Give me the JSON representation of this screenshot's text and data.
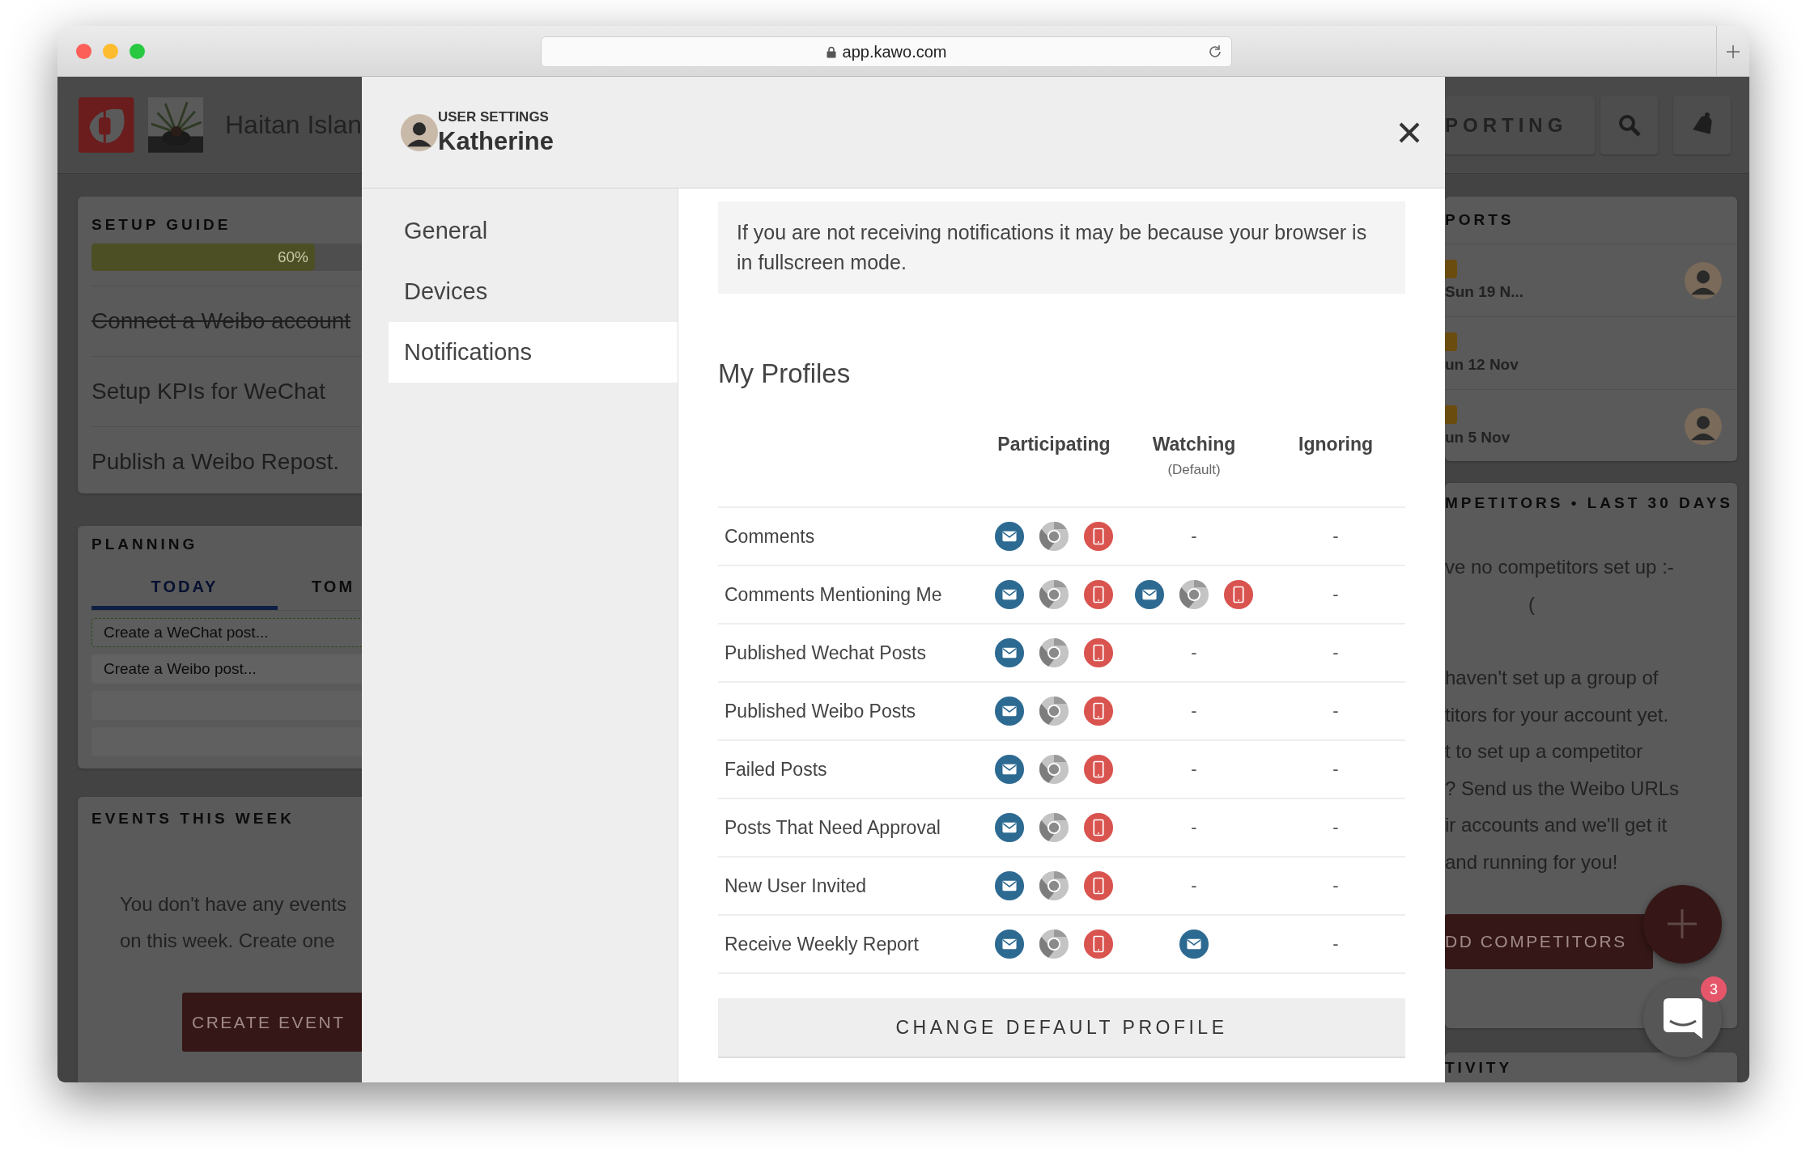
{
  "browser": {
    "url": "app.kawo.com"
  },
  "left": {
    "header_title": "Haitan Islan",
    "setup": {
      "title": "SETUP GUIDE",
      "progress": {
        "level": 0.6,
        "label": "60%"
      },
      "tasks": [
        {
          "label": "Connect a Weibo account",
          "done": true
        },
        {
          "label": "Setup KPIs for WeChat",
          "done": false
        },
        {
          "label": "Publish a Weibo Repost.",
          "done": false
        }
      ]
    },
    "planning": {
      "title": "PLANNING",
      "tabs": [
        {
          "label": "TODAY",
          "selected": true
        },
        {
          "label": "TOM",
          "selected": false
        }
      ],
      "fields": [
        {
          "placeholder": "Create a WeChat post...",
          "highlighted": true
        },
        {
          "placeholder": "Create a Weibo post...",
          "highlighted": false
        }
      ]
    },
    "events": {
      "title": "EVENTS THIS WEEK",
      "lines": [
        "You don't have any events",
        "on this week. Create one"
      ],
      "button": "CREATE EVENT"
    }
  },
  "right": {
    "nav_label": "PORTING",
    "reports": {
      "title": "PORTS",
      "items": [
        {
          "date": "Sun 19 N...",
          "avatar": true
        },
        {
          "date": "un 12 Nov",
          "avatar": false
        },
        {
          "date": "un 5 Nov",
          "avatar": true
        }
      ]
    },
    "competitors": {
      "title": "MPETITORS • LAST 30 DAYS",
      "lines": [
        "ve no competitors set up :-",
        "(",
        "haven't set up a group of",
        "titors for your account yet.",
        "t to set up a competitor",
        "? Send us the Weibo URLs",
        "ir accounts and we'll get it",
        "and running for you!"
      ],
      "button": "DD COMPETITORS"
    },
    "activity": {
      "title": "TIVITY"
    }
  },
  "modal": {
    "eyebrow": "USER SETTINGS",
    "name": "Katherine",
    "nav": [
      {
        "label": "General",
        "selected": false
      },
      {
        "label": "Devices",
        "selected": false
      },
      {
        "label": "Notifications",
        "selected": true
      }
    ],
    "notice": "If you are not receiving notifications it may be because your browser is in fullscreen mode.",
    "section_title": "My Profiles",
    "columns": [
      {
        "label": "Participating"
      },
      {
        "label": "Watching",
        "note": "(Default)"
      },
      {
        "label": "Ignoring"
      }
    ],
    "rows": [
      {
        "label": "Comments",
        "cells": [
          {
            "icons": [
              {
                "kind": "email"
              },
              {
                "kind": "browser"
              },
              {
                "kind": "mobile"
              }
            ]
          },
          {
            "text": "-"
          },
          {
            "text": "-"
          }
        ]
      },
      {
        "label": "Comments Mentioning Me",
        "cells": [
          {
            "icons": [
              {
                "kind": "email"
              },
              {
                "kind": "browser"
              },
              {
                "kind": "mobile"
              }
            ]
          },
          {
            "icons": [
              {
                "kind": "email"
              },
              {
                "kind": "browser"
              },
              {
                "kind": "mobile"
              }
            ]
          },
          {
            "text": "-"
          }
        ]
      },
      {
        "label": "Published Wechat Posts",
        "cells": [
          {
            "icons": [
              {
                "kind": "email"
              },
              {
                "kind": "browser"
              },
              {
                "kind": "mobile"
              }
            ]
          },
          {
            "text": "-"
          },
          {
            "text": "-"
          }
        ]
      },
      {
        "label": "Published Weibo Posts",
        "cells": [
          {
            "icons": [
              {
                "kind": "email"
              },
              {
                "kind": "browser"
              },
              {
                "kind": "mobile"
              }
            ]
          },
          {
            "text": "-"
          },
          {
            "text": "-"
          }
        ]
      },
      {
        "label": "Failed Posts",
        "cells": [
          {
            "icons": [
              {
                "kind": "email"
              },
              {
                "kind": "browser"
              },
              {
                "kind": "mobile"
              }
            ]
          },
          {
            "text": "-"
          },
          {
            "text": "-"
          }
        ]
      },
      {
        "label": "Posts That Need Approval",
        "cells": [
          {
            "icons": [
              {
                "kind": "email"
              },
              {
                "kind": "browser"
              },
              {
                "kind": "mobile"
              }
            ]
          },
          {
            "text": "-"
          },
          {
            "text": "-"
          }
        ]
      },
      {
        "label": "New User Invited",
        "cells": [
          {
            "icons": [
              {
                "kind": "email"
              },
              {
                "kind": "browser"
              },
              {
                "kind": "mobile"
              }
            ]
          },
          {
            "text": "-"
          },
          {
            "text": "-"
          }
        ]
      },
      {
        "label": "Receive Weekly Report",
        "cells": [
          {
            "icons": [
              {
                "kind": "email"
              },
              {
                "kind": "browser"
              },
              {
                "kind": "mobile"
              }
            ]
          },
          {
            "icons": [
              {
                "kind": "email"
              }
            ]
          },
          {
            "text": "-"
          }
        ]
      }
    ],
    "button": "CHANGE DEFAULT PROFILE"
  },
  "chat": {
    "badge": "3"
  }
}
